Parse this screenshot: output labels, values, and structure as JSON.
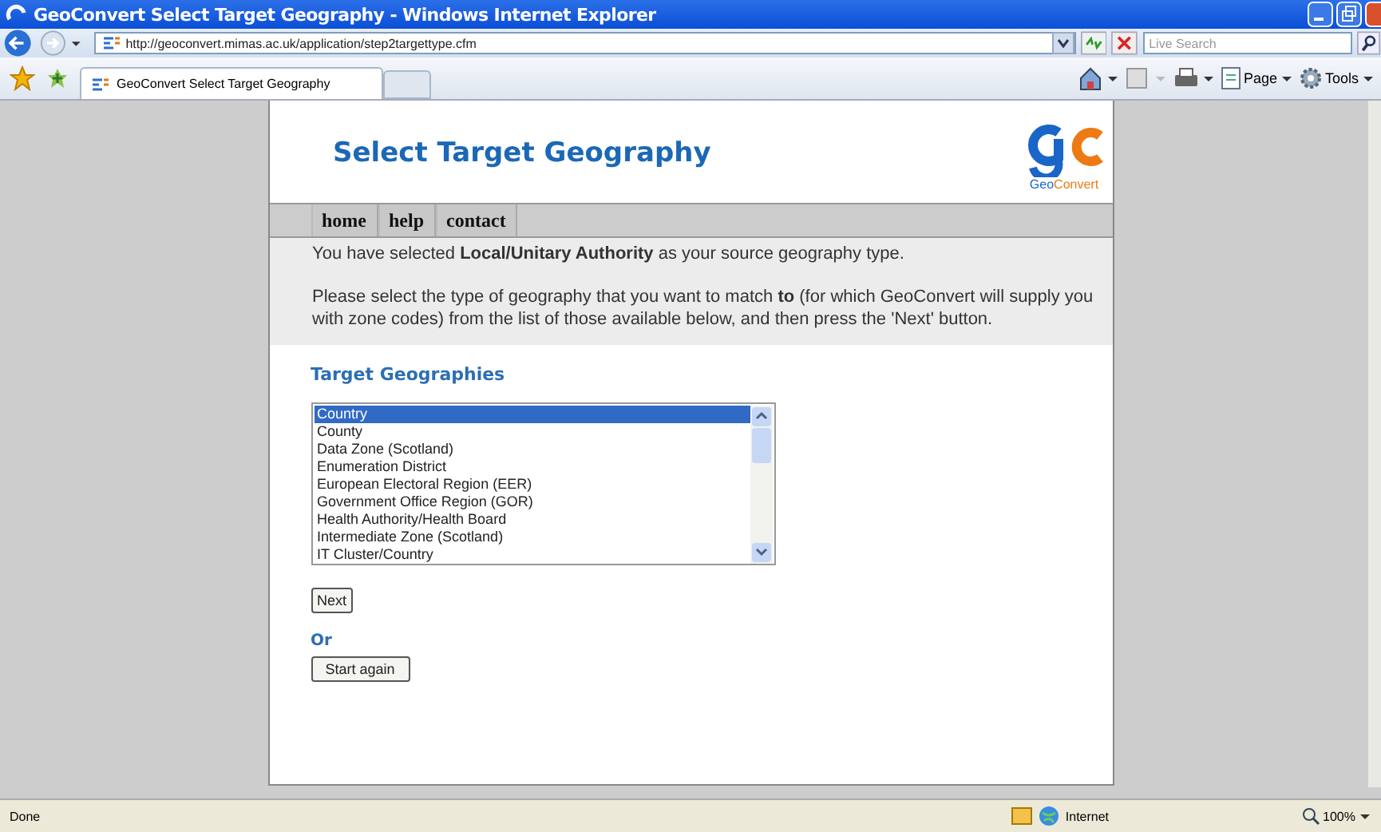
{
  "window": {
    "title": "GeoConvert Select Target Geography - Windows Internet Explorer"
  },
  "address_bar": {
    "url": "http://geoconvert.mimas.ac.uk/application/step2targettype.cfm"
  },
  "search": {
    "placeholder": "Live Search"
  },
  "browser_tabs": [
    {
      "label": "GeoConvert Select Target Geography",
      "selected": true
    }
  ],
  "toolbar": [
    {
      "label": "Page"
    },
    {
      "label": "Tools"
    }
  ],
  "page": {
    "heading": "Select Target Geography",
    "logo": {
      "part_1": "Geo",
      "part_2": "Convert"
    },
    "nav": [
      {
        "label": "home"
      },
      {
        "label": "help"
      },
      {
        "label": "contact"
      }
    ],
    "intro": [
      "You have selected **Local/Unitary Authority** as your source geography type.",
      "Please select the type of geography that you want to match **to** (for which GeoConvert will supply you with zone codes) from the list of those available below, and then press the 'Next' button."
    ],
    "section_title": "Target Geographies",
    "list": [
      {
        "label": "Country",
        "selected": true
      },
      {
        "label": "County",
        "selected": false
      },
      {
        "label": "Data Zone (Scotland)",
        "selected": false
      },
      {
        "label": "Enumeration District",
        "selected": false
      },
      {
        "label": "European Electoral Region (EER)",
        "selected": false
      },
      {
        "label": "Government Office Region (GOR)",
        "selected": false
      },
      {
        "label": "Health Authority/Health Board",
        "selected": false
      },
      {
        "label": "Intermediate Zone (Scotland)",
        "selected": false
      },
      {
        "label": "IT Cluster/Country",
        "selected": false
      }
    ],
    "next_button": "Next",
    "or_label": "Or",
    "start_again_button": "Start again"
  },
  "status_bar": {
    "status": "Done",
    "zone": "Internet",
    "zoom": "100%"
  }
}
